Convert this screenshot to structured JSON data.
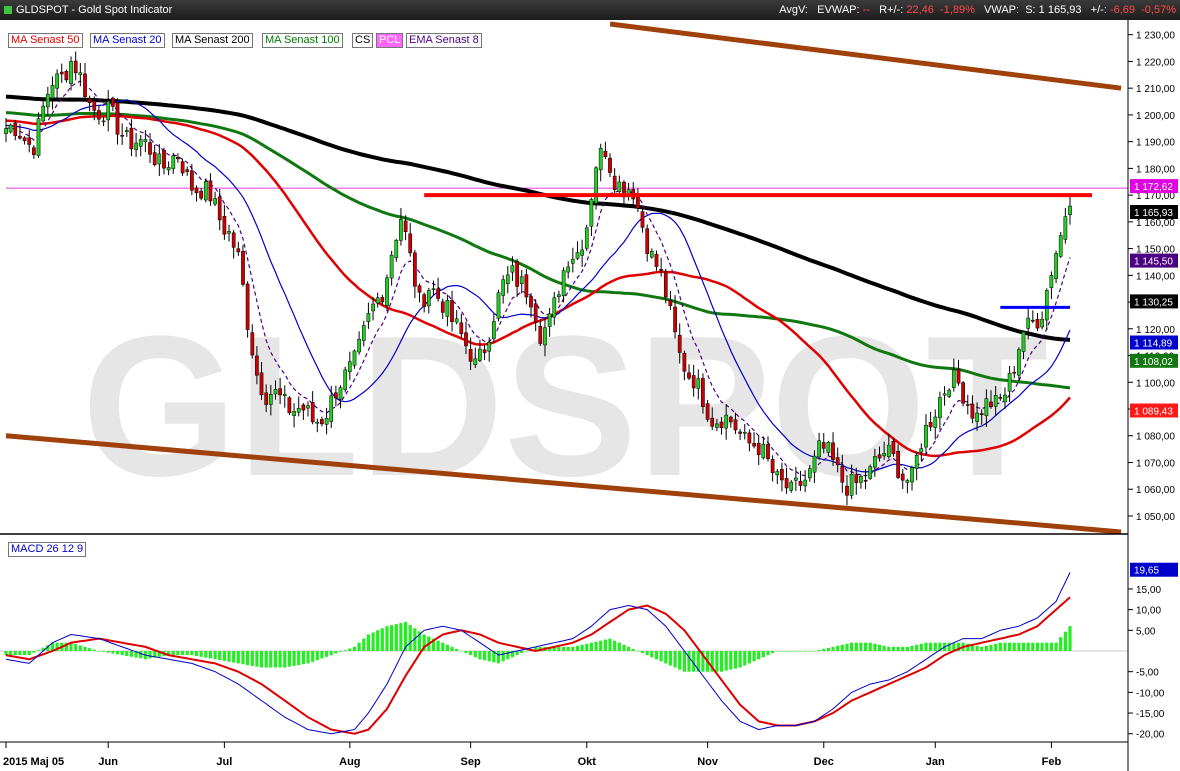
{
  "window": {
    "title": "GLDSPOT - Gold Spot Indicator",
    "avgv_label": "AvgV:",
    "evwap_label": "EVWAP:",
    "evwap_value": "--",
    "rchange_label": "R+/-:",
    "rchange_value": "22,46",
    "rchange_pct": "-1,89%",
    "vwap_label": "VWAP:",
    "last_label": "S:",
    "last_value": "1 165,93",
    "change_label": "+/-:",
    "change_value": "-6,69",
    "change_pct": "-0,57%"
  },
  "watermark": "GLDSPOT",
  "legend": [
    {
      "label": "MA Senast 50",
      "color": "#e00000"
    },
    {
      "label": "MA Senast 20",
      "color": "#0000cc"
    },
    {
      "label": "MA Senast 200",
      "color": "#000000"
    },
    {
      "label": "MA Senast 100",
      "color": "#007a00"
    },
    {
      "label": "CS",
      "color": "#000000"
    },
    {
      "label": "PCL",
      "color": "#e000e0"
    },
    {
      "label": "EMA Senast 8",
      "color": "#4b0082"
    }
  ],
  "macd_legend": {
    "label": "MACD 26 12 9",
    "color": "#0000cc"
  },
  "colors": {
    "up": "#22cc22",
    "down": "#cc0000",
    "ma50": "#e00000",
    "ma20": "#0000cc",
    "ma200": "#000000",
    "ma100": "#117711",
    "ema8": "#4b0082",
    "channel": "#a0400a",
    "resistance": "#ff0000",
    "support": "#0000ff",
    "pcl": "#e000e0",
    "macd_line": "#0000cc",
    "signal_line": "#dd0000",
    "histogram": "#22ee22"
  },
  "chart_data": [
    {
      "type": "candlestick",
      "panel": "price",
      "x_axis": [
        "2015 Maj 05",
        "Jun",
        "Jul",
        "Aug",
        "Sep",
        "Okt",
        "Nov",
        "Dec",
        "Jan",
        "Feb"
      ],
      "y_axis": [
        "1 050,00",
        "1 060,00",
        "1 070,00",
        "1 080,00",
        "1 090,00",
        "1 100,00",
        "1 110,00",
        "1 120,00",
        "1 130,00",
        "1 140,00",
        "1 150,00",
        "1 160,00",
        "1 170,00",
        "1 180,00",
        "1 190,00",
        "1 200,00",
        "1 210,00",
        "1 220,00",
        "1 230,00"
      ],
      "ylim": [
        1044,
        1234
      ],
      "price_path": [
        [
          0,
          1195
        ],
        [
          6,
          1190
        ],
        [
          10,
          1212
        ],
        [
          14,
          1220
        ],
        [
          18,
          1205
        ],
        [
          22,
          1200
        ],
        [
          24,
          1195
        ],
        [
          28,
          1190
        ],
        [
          32,
          1185
        ],
        [
          34,
          1182
        ],
        [
          37,
          1183
        ],
        [
          40,
          1175
        ],
        [
          42,
          1172
        ],
        [
          44,
          1168
        ],
        [
          46,
          1162
        ],
        [
          48,
          1157
        ],
        [
          50,
          1145
        ],
        [
          52,
          1122
        ],
        [
          54,
          1105
        ],
        [
          56,
          1095
        ],
        [
          60,
          1093
        ],
        [
          63,
          1090
        ],
        [
          66,
          1085
        ],
        [
          69,
          1090
        ],
        [
          72,
          1098
        ],
        [
          75,
          1110
        ],
        [
          78,
          1122
        ],
        [
          81,
          1135
        ],
        [
          83,
          1150
        ],
        [
          85,
          1160
        ],
        [
          87,
          1146
        ],
        [
          89,
          1132
        ],
        [
          91,
          1135
        ],
        [
          93,
          1130
        ],
        [
          95,
          1128
        ],
        [
          97,
          1122
        ],
        [
          99,
          1112
        ],
        [
          101,
          1106
        ],
        [
          103,
          1115
        ],
        [
          105,
          1125
        ],
        [
          107,
          1135
        ],
        [
          109,
          1142
        ],
        [
          111,
          1138
        ],
        [
          113,
          1130
        ],
        [
          115,
          1118
        ],
        [
          117,
          1125
        ],
        [
          119,
          1135
        ],
        [
          121,
          1145
        ],
        [
          123,
          1150
        ],
        [
          125,
          1160
        ],
        [
          127,
          1180
        ],
        [
          129,
          1187
        ],
        [
          131,
          1178
        ],
        [
          133,
          1172
        ],
        [
          135,
          1170
        ],
        [
          137,
          1160
        ],
        [
          139,
          1148
        ],
        [
          141,
          1138
        ],
        [
          143,
          1125
        ],
        [
          145,
          1112
        ],
        [
          147,
          1102
        ],
        [
          150,
          1094
        ],
        [
          152,
          1088
        ],
        [
          155,
          1085
        ],
        [
          158,
          1082
        ],
        [
          161,
          1076
        ],
        [
          164,
          1070
        ],
        [
          167,
          1063
        ],
        [
          169,
          1057
        ],
        [
          171,
          1062
        ],
        [
          173,
          1068
        ],
        [
          175,
          1074
        ],
        [
          177,
          1072
        ],
        [
          179,
          1068
        ],
        [
          181,
          1062
        ],
        [
          183,
          1060
        ],
        [
          185,
          1064
        ],
        [
          187,
          1072
        ],
        [
          189,
          1073
        ],
        [
          191,
          1070
        ],
        [
          193,
          1066
        ],
        [
          195,
          1065
        ],
        [
          197,
          1076
        ],
        [
          199,
          1086
        ],
        [
          201,
          1096
        ],
        [
          203,
          1100
        ],
        [
          205,
          1098
        ],
        [
          207,
          1094
        ],
        [
          209,
          1088
        ],
        [
          211,
          1090
        ],
        [
          213,
          1092
        ],
        [
          215,
          1098
        ],
        [
          217,
          1105
        ],
        [
          219,
          1118
        ],
        [
          221,
          1124
        ],
        [
          223,
          1127
        ],
        [
          225,
          1140
        ],
        [
          227,
          1155
        ],
        [
          228,
          1165
        ],
        [
          229,
          1171
        ]
      ],
      "overlays": {
        "ma200": {
          "label": "MA Senast 200",
          "last": "1 130,25"
        },
        "ma20": {
          "label": "MA Senast 20",
          "last": "1 114,89"
        },
        "ma100": {
          "label": "MA Senast 100",
          "last": "1 108,02"
        },
        "ma50": {
          "label": "MA Senast 50",
          "last": "1 089,43"
        },
        "ema8": {
          "label": "EMA Senast 8",
          "last": "1 145,50"
        },
        "pcl": {
          "label": "PCL",
          "value": "1 172,62"
        },
        "last_close": "1 165,93"
      },
      "levels": {
        "resistance": 1170,
        "support": 1128,
        "channel_upper": {
          "from": [
            130,
            1234
          ],
          "to": [
            240,
            1210
          ]
        },
        "channel_lower": {
          "from": [
            0,
            1080
          ],
          "to": [
            240,
            1044
          ]
        }
      }
    },
    {
      "type": "macd",
      "panel": "indicator",
      "title": "MACD 26 12 9",
      "y_axis": [
        "-20,00",
        "-15,00",
        "-10,00",
        "-5,00",
        "5,00",
        "10,00",
        "15,00"
      ],
      "ylim": [
        -22,
        22
      ],
      "last": "19,65",
      "macd": [
        [
          0,
          -2
        ],
        [
          5,
          -3
        ],
        [
          10,
          2
        ],
        [
          14,
          4
        ],
        [
          20,
          3
        ],
        [
          25,
          1
        ],
        [
          30,
          -1
        ],
        [
          35,
          -2
        ],
        [
          40,
          -3
        ],
        [
          45,
          -5
        ],
        [
          50,
          -8
        ],
        [
          55,
          -12
        ],
        [
          60,
          -16
        ],
        [
          65,
          -19
        ],
        [
          70,
          -20
        ],
        [
          75,
          -19
        ],
        [
          78,
          -15
        ],
        [
          82,
          -8
        ],
        [
          86,
          1
        ],
        [
          90,
          5
        ],
        [
          94,
          6
        ],
        [
          98,
          5
        ],
        [
          102,
          2
        ],
        [
          106,
          -1
        ],
        [
          110,
          0
        ],
        [
          114,
          1
        ],
        [
          118,
          2
        ],
        [
          122,
          3
        ],
        [
          126,
          6
        ],
        [
          130,
          10
        ],
        [
          134,
          11
        ],
        [
          138,
          10
        ],
        [
          142,
          6
        ],
        [
          146,
          0
        ],
        [
          150,
          -6
        ],
        [
          154,
          -12
        ],
        [
          158,
          -17
        ],
        [
          162,
          -19
        ],
        [
          166,
          -18
        ],
        [
          170,
          -18
        ],
        [
          174,
          -17
        ],
        [
          178,
          -14
        ],
        [
          182,
          -10
        ],
        [
          186,
          -8
        ],
        [
          190,
          -7
        ],
        [
          194,
          -5
        ],
        [
          198,
          -2
        ],
        [
          202,
          1
        ],
        [
          206,
          3
        ],
        [
          210,
          3
        ],
        [
          214,
          5
        ],
        [
          218,
          6
        ],
        [
          222,
          8
        ],
        [
          226,
          12
        ],
        [
          229,
          19
        ]
      ],
      "signal": [
        [
          0,
          -1
        ],
        [
          5,
          -2
        ],
        [
          10,
          0
        ],
        [
          14,
          2
        ],
        [
          20,
          3
        ],
        [
          25,
          2
        ],
        [
          30,
          1
        ],
        [
          35,
          -1
        ],
        [
          40,
          -2
        ],
        [
          45,
          -3
        ],
        [
          50,
          -5
        ],
        [
          55,
          -8
        ],
        [
          60,
          -12
        ],
        [
          65,
          -16
        ],
        [
          70,
          -19
        ],
        [
          75,
          -20
        ],
        [
          78,
          -19
        ],
        [
          82,
          -14
        ],
        [
          86,
          -6
        ],
        [
          90,
          1
        ],
        [
          94,
          4
        ],
        [
          98,
          5
        ],
        [
          102,
          4
        ],
        [
          106,
          2
        ],
        [
          110,
          1
        ],
        [
          114,
          0
        ],
        [
          118,
          1
        ],
        [
          122,
          2
        ],
        [
          126,
          4
        ],
        [
          130,
          7
        ],
        [
          134,
          10
        ],
        [
          138,
          11
        ],
        [
          142,
          9
        ],
        [
          146,
          5
        ],
        [
          150,
          -1
        ],
        [
          154,
          -7
        ],
        [
          158,
          -13
        ],
        [
          162,
          -17
        ],
        [
          166,
          -18
        ],
        [
          170,
          -18
        ],
        [
          174,
          -17
        ],
        [
          178,
          -15
        ],
        [
          182,
          -12
        ],
        [
          186,
          -10
        ],
        [
          190,
          -8
        ],
        [
          194,
          -6
        ],
        [
          198,
          -4
        ],
        [
          202,
          -1
        ],
        [
          206,
          1
        ],
        [
          210,
          2
        ],
        [
          214,
          3
        ],
        [
          218,
          4
        ],
        [
          222,
          6
        ],
        [
          226,
          10
        ],
        [
          229,
          13
        ]
      ]
    }
  ]
}
